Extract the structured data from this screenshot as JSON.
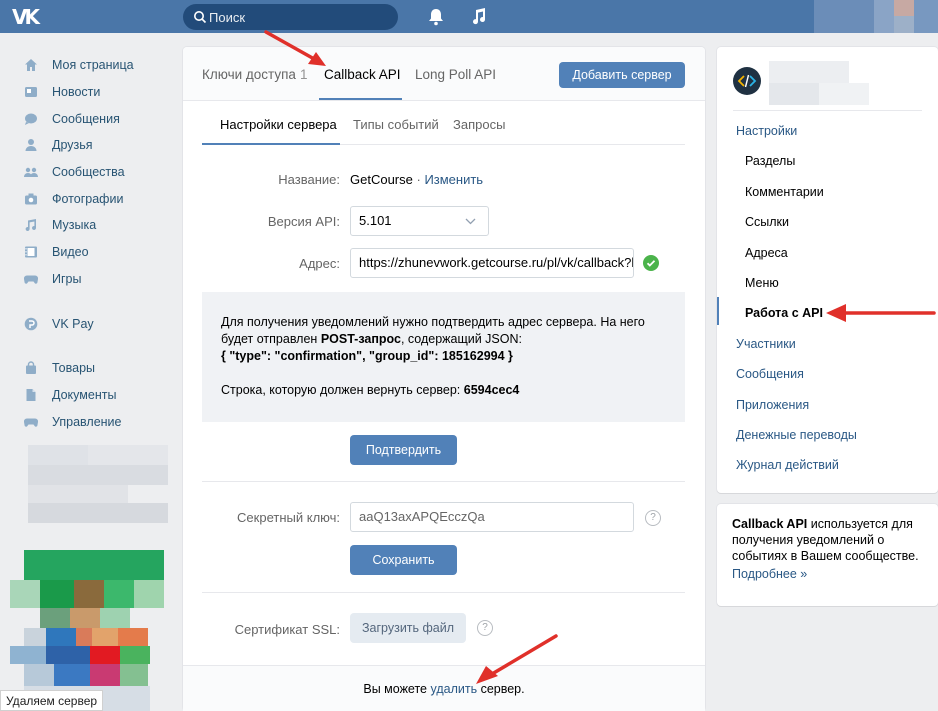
{
  "topbar": {
    "logo": "VK",
    "search_placeholder": "Поиск",
    "icons": [
      "search-icon",
      "bell-icon",
      "music-icon"
    ]
  },
  "leftnav": {
    "items": [
      {
        "label": "Моя страница",
        "icon": "home-icon"
      },
      {
        "label": "Новости",
        "icon": "news-icon"
      },
      {
        "label": "Сообщения",
        "icon": "messages-icon"
      },
      {
        "label": "Друзья",
        "icon": "friends-icon"
      },
      {
        "label": "Сообщества",
        "icon": "communities-icon"
      },
      {
        "label": "Фотографии",
        "icon": "camera-icon"
      },
      {
        "label": "Музыка",
        "icon": "music-icon"
      },
      {
        "label": "Видео",
        "icon": "video-icon"
      },
      {
        "label": "Игры",
        "icon": "gamepad-icon"
      }
    ],
    "pay": {
      "label": "VK Pay",
      "icon": "vkpay-icon"
    },
    "extra": [
      {
        "label": "Товары",
        "icon": "bag-icon"
      },
      {
        "label": "Документы",
        "icon": "document-icon"
      },
      {
        "label": "Управление",
        "icon": "gamepad-icon"
      }
    ]
  },
  "caption": "Удаляем сервер",
  "main": {
    "tabs": [
      {
        "label": "Ключи доступа",
        "count": "1"
      },
      {
        "label": "Callback API"
      },
      {
        "label": "Long Poll API"
      }
    ],
    "add_server_label": "Добавить сервер",
    "subtabs": [
      "Настройки сервера",
      "Типы событий",
      "Запросы"
    ],
    "form": {
      "name_label": "Название:",
      "name_value": "GetCourse",
      "name_sep": " · ",
      "name_edit": "Изменить",
      "api_label": "Версия API:",
      "api_value": "5.101",
      "address_label": "Адрес:",
      "address_value": "https://zhunevwork.getcourse.ru/pl/vk/callback?h"
    },
    "info": {
      "line1": "Для получения уведомлений нужно подтвердить адрес сервера. На него будет отправлен ",
      "post": "POST-запрос",
      "line1b": ", содержащий JSON:",
      "json": "{ \"type\": \"confirmation\", \"group_id\": 185162994 }",
      "line2": "Строка, которую должен вернуть сервер: ",
      "code": "6594cec4"
    },
    "confirm_label": "Подтвердить",
    "secret_label": "Секретный ключ:",
    "secret_value": "aaQ13axAPQEcczQa",
    "save_label": "Сохранить",
    "ssl_label": "Сертификат SSL:",
    "upload_label": "Загрузить файл",
    "help_mark": "?",
    "footer": {
      "pre": "Вы можете ",
      "link": "удалить",
      "post": " сервер."
    }
  },
  "right": {
    "items": [
      {
        "label": "Настройки",
        "level": "top"
      },
      {
        "label": "Разделы",
        "level": "sub"
      },
      {
        "label": "Комментарии",
        "level": "sub"
      },
      {
        "label": "Ссылки",
        "level": "sub"
      },
      {
        "label": "Адреса",
        "level": "sub"
      },
      {
        "label": "Меню",
        "level": "sub"
      },
      {
        "label": "Работа с API",
        "level": "sub",
        "active": true
      },
      {
        "label": "Участники",
        "level": "top"
      },
      {
        "label": "Сообщения",
        "level": "top"
      },
      {
        "label": "Приложения",
        "level": "top"
      },
      {
        "label": "Денежные переводы",
        "level": "top"
      },
      {
        "label": "Журнал действий",
        "level": "top"
      }
    ],
    "info": {
      "bold": "Callback API",
      "text": " используется для получения уведомлений о событиях в Вашем сообществе.",
      "more": "Подробнее »"
    }
  },
  "colors": {
    "accent": "#5181b8",
    "header": "#4a76a8",
    "link": "#2a5885",
    "arrow": "#e0302a",
    "check": "#4bb34b"
  }
}
